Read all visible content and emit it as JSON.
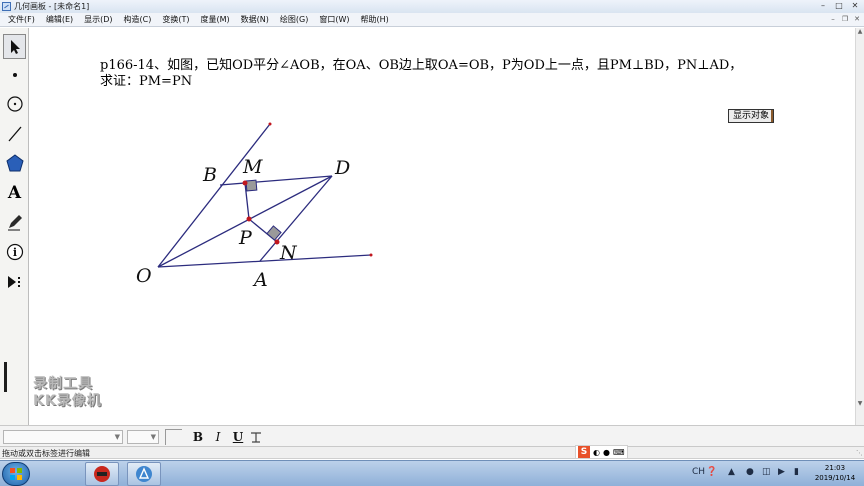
{
  "window": {
    "title": "几何画板 - [未命名1]",
    "minimize_icon": "minimize-icon",
    "maximize_icon": "maximize-icon",
    "close_icon": "close-icon"
  },
  "menubar": {
    "items": [
      {
        "label": "文件(F)"
      },
      {
        "label": "编辑(E)"
      },
      {
        "label": "显示(D)"
      },
      {
        "label": "构造(C)"
      },
      {
        "label": "变换(T)"
      },
      {
        "label": "度量(M)"
      },
      {
        "label": "数据(N)"
      },
      {
        "label": "绘图(G)"
      },
      {
        "label": "窗口(W)"
      },
      {
        "label": "帮助(H)"
      }
    ]
  },
  "toolbox": {
    "tools": [
      {
        "name": "arrow-select-tool",
        "icon": "arrow-icon",
        "active": true
      },
      {
        "name": "point-tool",
        "icon": "point-icon"
      },
      {
        "name": "compass-tool",
        "icon": "circle-icon"
      },
      {
        "name": "straightedge-tool",
        "icon": "line-icon"
      },
      {
        "name": "polygon-tool",
        "icon": "polygon-icon"
      },
      {
        "name": "text-tool",
        "icon": "text-a-icon",
        "glyph": "A"
      },
      {
        "name": "marker-tool",
        "icon": "pencil-icon"
      },
      {
        "name": "information-tool",
        "icon": "info-icon",
        "glyph": "i"
      },
      {
        "name": "custom-tool",
        "icon": "play-menu-icon"
      }
    ]
  },
  "canvas": {
    "problem_line1": "p166-14、如图，已知OD平分∠AOB，在OA、OB边上取OA=OB，P为OD上一点，且PM⊥BD，PN⊥AD，",
    "problem_line2": "求证：PM=PN",
    "show_object_button": "显示对象",
    "labels": {
      "B": "B",
      "M": "M",
      "D": "D",
      "P": "P",
      "N": "N",
      "O": "O",
      "A": "A"
    },
    "watermark_line1": "录制工具",
    "watermark_line2": "KK录像机",
    "colors": {
      "segment": "#2c2c7e",
      "point": "#c0171f",
      "right_angle_fill": "#9a9a9a"
    }
  },
  "formatbar": {
    "font_name": "",
    "font_size": "",
    "bold_label": "B",
    "italic_label": "I",
    "underline_label": "U",
    "style_icon": "text-style-icon"
  },
  "statusbar": {
    "text": "拖动或双击标签进行编辑"
  },
  "taskbar": {
    "start_icon": "windows-logo-icon",
    "apps": [
      {
        "icon": "kk-recorder-icon"
      },
      {
        "icon": "geometer-sketchpad-icon"
      }
    ],
    "tray": {
      "ime_label": "S",
      "lang": "CH",
      "time": "21:03",
      "date": "2019/10/14"
    }
  }
}
